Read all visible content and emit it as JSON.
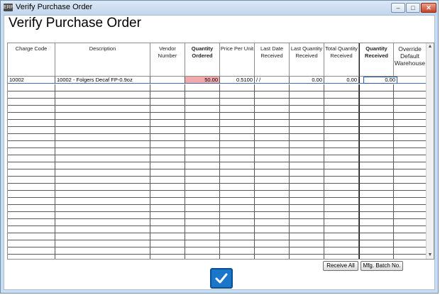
{
  "window": {
    "app_icon_text": "ERP",
    "title": "Verify Purchase Order",
    "min_glyph": "–",
    "max_glyph": "□",
    "close_glyph": "✕"
  },
  "page": {
    "title": "Verify Purchase Order"
  },
  "grid": {
    "columns": [
      "Charge Code",
      "Description",
      "Vendor Number",
      "Quantity Ordered",
      "Price Per Unit",
      "Last Date Received",
      "Last Quantity Received",
      "Total Quantity Received",
      "Quantity Received",
      "Override Default Warehouse"
    ],
    "rows": [
      {
        "charge_code": "10002",
        "description": "10002 - Folgers Decaf FP-0.9oz",
        "vendor_number": "",
        "quantity_ordered": "50.00",
        "price_per_unit": "0.5100",
        "last_date_received": " /  /",
        "last_quantity_received": "0.00",
        "total_quantity_received": "0.00",
        "quantity_received": "0.00",
        "override_default_warehouse": ""
      }
    ],
    "scroll_up_glyph": "▲",
    "scroll_down_glyph": "▼"
  },
  "buttons": {
    "receive_all": "Receive All",
    "mfg_batch_no": "Mfg. Batch No."
  },
  "colors": {
    "quantity_ordered_highlight": "#f2a9a9",
    "confirm_button": "#1976c9"
  }
}
